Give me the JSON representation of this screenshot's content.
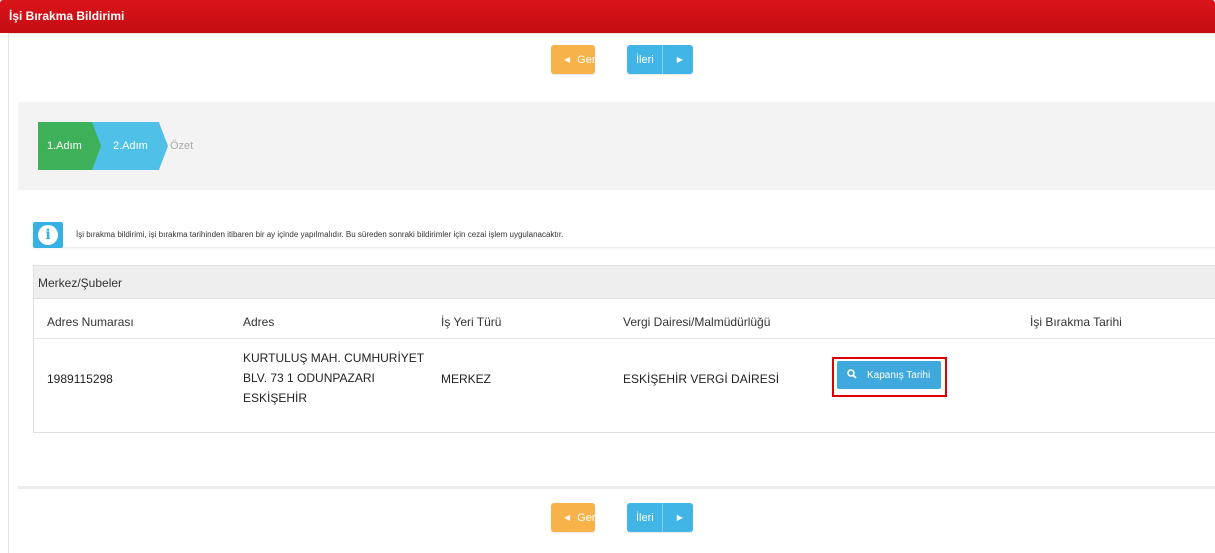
{
  "window": {
    "title": "İşi Bırakma Bildirimi"
  },
  "nav": {
    "back_label": "Geri",
    "next_label": "İleri",
    "back_arrow": "◀",
    "next_arrow": "▶"
  },
  "steps": [
    {
      "label": "1.Adım"
    },
    {
      "label": "2.Adım"
    },
    {
      "label": "Özet"
    }
  ],
  "info": {
    "icon_text": "i",
    "text": "İşi bırakma bildirimi, işi bırakma tarihinden itibaren bir ay içinde yapılmalıdır. Bu süreden sonraki bildirimler için cezai işlem uygulanacaktır."
  },
  "table": {
    "title": "Merkez/Şubeler",
    "columns": [
      "Adres Numarası",
      "Adres",
      "İş Yeri Türü",
      "Vergi Dairesi/Malmüdürlüğü",
      "İşi Bırakma Tarihi"
    ],
    "rows": [
      {
        "adres_numarasi": "1989115298",
        "adres_line1": "KURTULUŞ MAH. CUMHURİYET",
        "adres_line2": "BLV. 73 1 ODUNPAZARI",
        "adres_line3": "ESKİŞEHİR",
        "is_yeri_turu": "MERKEZ",
        "vergi_dairesi": "ESKİŞEHİR VERGİ DAİRESİ",
        "button_label": "Kapanış Tarihi",
        "button_icon": "search-icon"
      }
    ]
  },
  "colors": {
    "title_bar": "#d9141a",
    "back_button": "#f7b24a",
    "next_button": "#41b6e6",
    "step1": "#3fb05a",
    "step2": "#4fc1e8",
    "highlight": "#e00000"
  }
}
